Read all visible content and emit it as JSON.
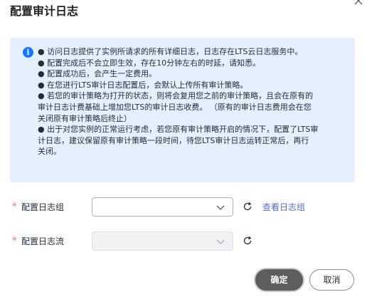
{
  "dialog": {
    "title": "配置审计日志"
  },
  "notice": {
    "icon": "info-icon",
    "lines": [
      "● 访问日志提供了实例所请求的所有详细日志，日志存在LTS云日志服务中。",
      "● 配置完成后不会立即生效，存在10分钟左右的时延，请知悉。",
      "● 配置成功后，会产生一定费用。",
      "● 在您进行LTS审计日志配置后，会默认上传所有审计策略。",
      "● 若您的审计策略为打开的状态，则将会复用您之前的审计策略，且会在原有的",
      "审计日志计费基础上增加您LTS的审计日志收费。 （原有的审计日志费用会在您",
      "关闭原有审计策略后终止）",
      "● 出于对您实例的正常运行考虑，若您原有审计策略开启的情况下，配置了LTS审",
      "计日志，建议保留原有审计策略一段时间，待您LTS审计日志运转正常后，再行",
      "关闭。"
    ]
  },
  "form": {
    "log_group": {
      "required_mark": "*",
      "label": "配置日志组",
      "value": "",
      "link": "查看日志组"
    },
    "log_stream": {
      "required_mark": "*",
      "label": "配置日志流",
      "value": ""
    }
  },
  "buttons": {
    "ok": "确定",
    "cancel": "取消"
  },
  "colors": {
    "notice_bg": "#e5f0fe",
    "info_icon": "#1476ff",
    "required": "#f66f6a",
    "link": "#526ecc",
    "primary_button": "#5e5e5e"
  }
}
